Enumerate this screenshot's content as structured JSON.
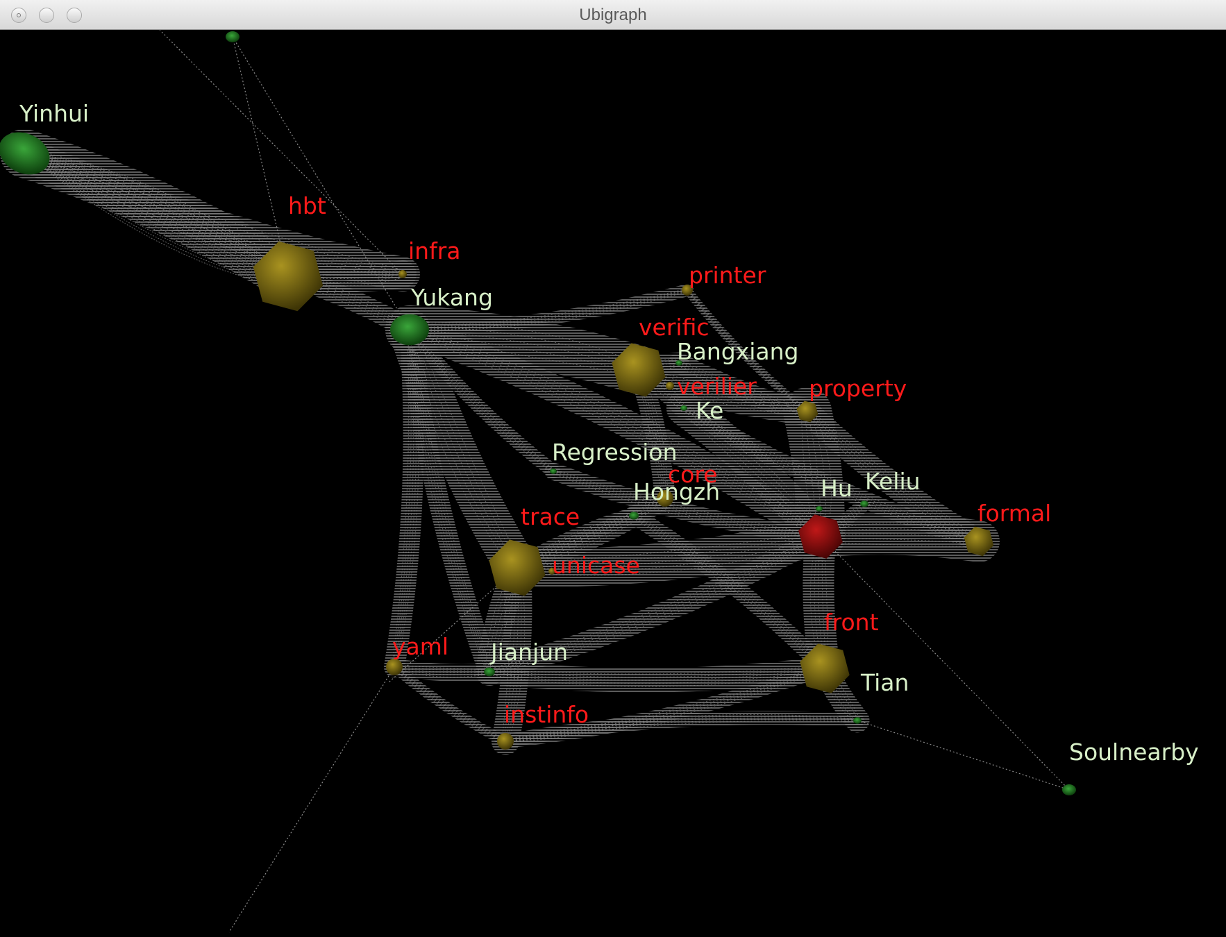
{
  "window": {
    "title": "Ubigraph",
    "controls": [
      "close",
      "minimize",
      "zoom"
    ]
  },
  "graph": {
    "colors": {
      "background": "#000000",
      "edge": "#8a8a8a",
      "user_node": "#1f6e1f",
      "topic_node": "#7a6a10",
      "topic_node_highlight": "#8a1010",
      "user_label": "#d8f0c8",
      "topic_label": "#ff1a1a"
    },
    "user_nodes": [
      {
        "id": "yinhui",
        "label": "Yinhui"
      },
      {
        "id": "yukang",
        "label": "Yukang"
      },
      {
        "id": "bangxiang",
        "label": "Bangxiang"
      },
      {
        "id": "ke",
        "label": "Ke"
      },
      {
        "id": "regression",
        "label": "Regression"
      },
      {
        "id": "hongzh",
        "label": "Hongzh"
      },
      {
        "id": "hu",
        "label": "Hu"
      },
      {
        "id": "keliu",
        "label": "Keliu"
      },
      {
        "id": "jianjun",
        "label": "Jianjun"
      },
      {
        "id": "tian",
        "label": "Tian"
      },
      {
        "id": "soulnearby",
        "label": "Soulnearby"
      },
      {
        "id": "top",
        "label": ""
      }
    ],
    "topic_nodes": [
      {
        "id": "hbt",
        "label": "hbt"
      },
      {
        "id": "infra",
        "label": "infra"
      },
      {
        "id": "printer",
        "label": "printer"
      },
      {
        "id": "verific",
        "label": "verific"
      },
      {
        "id": "verilier",
        "label": "verilier"
      },
      {
        "id": "property",
        "label": "property"
      },
      {
        "id": "core",
        "label": "core"
      },
      {
        "id": "trace",
        "label": "trace"
      },
      {
        "id": "unicase",
        "label": "unicase"
      },
      {
        "id": "formal",
        "label": "formal"
      },
      {
        "id": "center",
        "label": ""
      },
      {
        "id": "front",
        "label": "front"
      },
      {
        "id": "yaml",
        "label": "yaml"
      },
      {
        "id": "instinfo",
        "label": "instinfo"
      }
    ]
  }
}
